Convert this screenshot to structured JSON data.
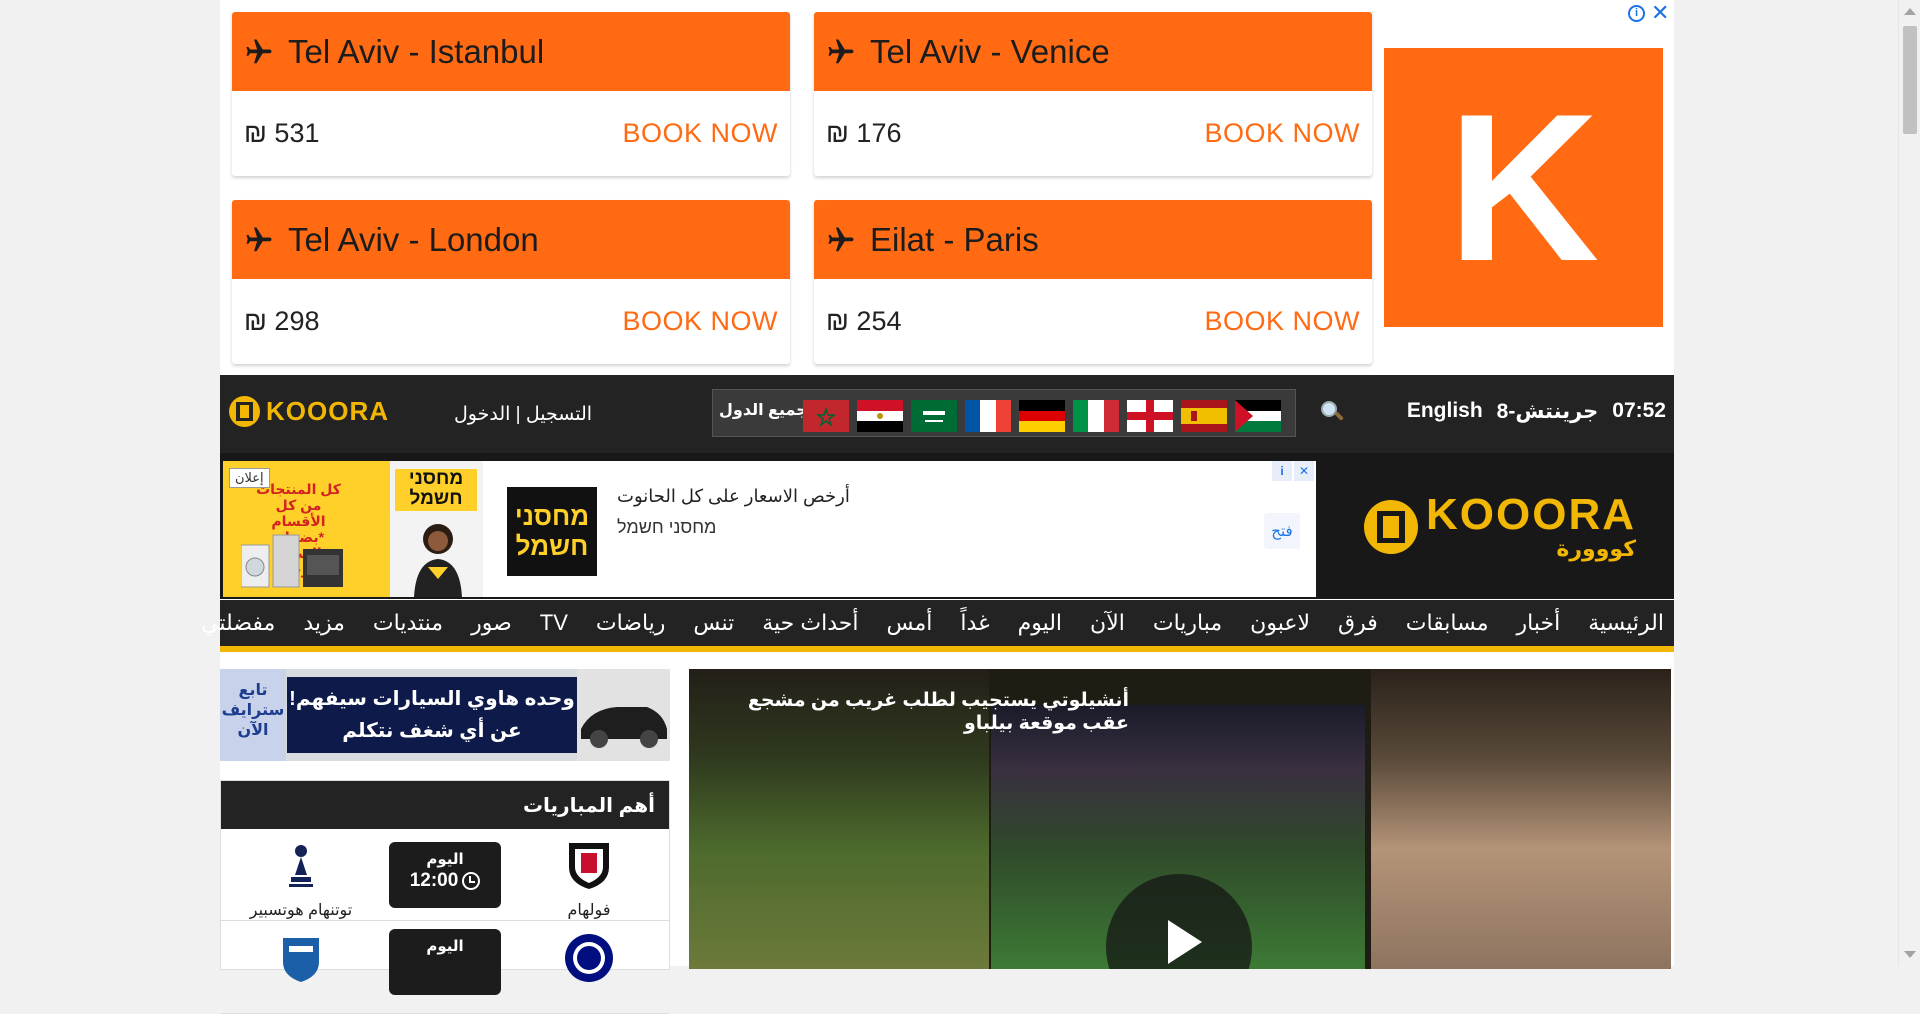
{
  "flight_ad": {
    "cards": [
      {
        "route": "Tel Aviv - Istanbul",
        "price": "₪ 531",
        "cta": "BOOK NOW"
      },
      {
        "route": "Tel Aviv - Venice",
        "price": "₪ 176",
        "cta": "BOOK NOW"
      },
      {
        "route": "Tel Aviv - London",
        "price": "₪ 298",
        "cta": "BOOK NOW"
      },
      {
        "route": "Eilat - Paris",
        "price": "₪ 254",
        "cta": "BOOK NOW"
      }
    ],
    "brand_letter": "K",
    "adchoices_info": "i",
    "adchoices_close": "✕"
  },
  "header": {
    "logo_text": "KOOORA",
    "login": "التسجيل | الدخول",
    "all_countries": "جميع الدول",
    "flags": [
      "morocco-flag",
      "egypt-flag",
      "saudi-flag",
      "france-flag",
      "germany-flag",
      "italy-flag",
      "england-flag",
      "spain-flag",
      "palestine-flag"
    ],
    "time": "07:52",
    "date": "8-جرينتش",
    "language": "English"
  },
  "banner": {
    "ad_label": "إعلان",
    "promo_text": "كل المنتجات من كل الأقسام *بضمان السعر* الأرخص",
    "woman_brand": "מחסני חשמל",
    "logo_brand": "מחסני חשמל",
    "headline": "أرخص الاسعار على كل الحانوت",
    "advertiser": "מחסני חשמל",
    "open_label": "فتح",
    "kooora_text": "KOOORA",
    "kooora_arabic": "كووورة"
  },
  "nav": {
    "items": [
      "الرئيسية",
      "أخبار",
      "مسابقات",
      "فرق",
      "لاعبون",
      "|",
      "مباريات",
      "الآن",
      "اليوم",
      "غداً",
      "أمس",
      "|",
      "أحداث حية",
      "تنس",
      "رياضات",
      "TV",
      "صور",
      "منتديات",
      "مزيد",
      "مفضلتي"
    ]
  },
  "car_ad": {
    "follow": "تابع سترايف الآن",
    "line1": "وحده هاوي السيارات سيفهم!",
    "line2": "عن أي شغف نتكلم"
  },
  "top_matches": {
    "title": "أهم المباريات",
    "matches": [
      {
        "home": "فولهام",
        "away": "توتنهام هوتسبير",
        "day": "اليوم",
        "time": "12:00"
      },
      {
        "home": "",
        "away": "",
        "day": "اليوم",
        "time": ""
      }
    ]
  },
  "video": {
    "title": "أنشيلوتي يستجيب لطلب غريب من مشجع عقب موقعة بيلباو"
  },
  "colors": {
    "orange": "#ff6a13",
    "gold": "#f2b705",
    "dark": "#232323"
  }
}
